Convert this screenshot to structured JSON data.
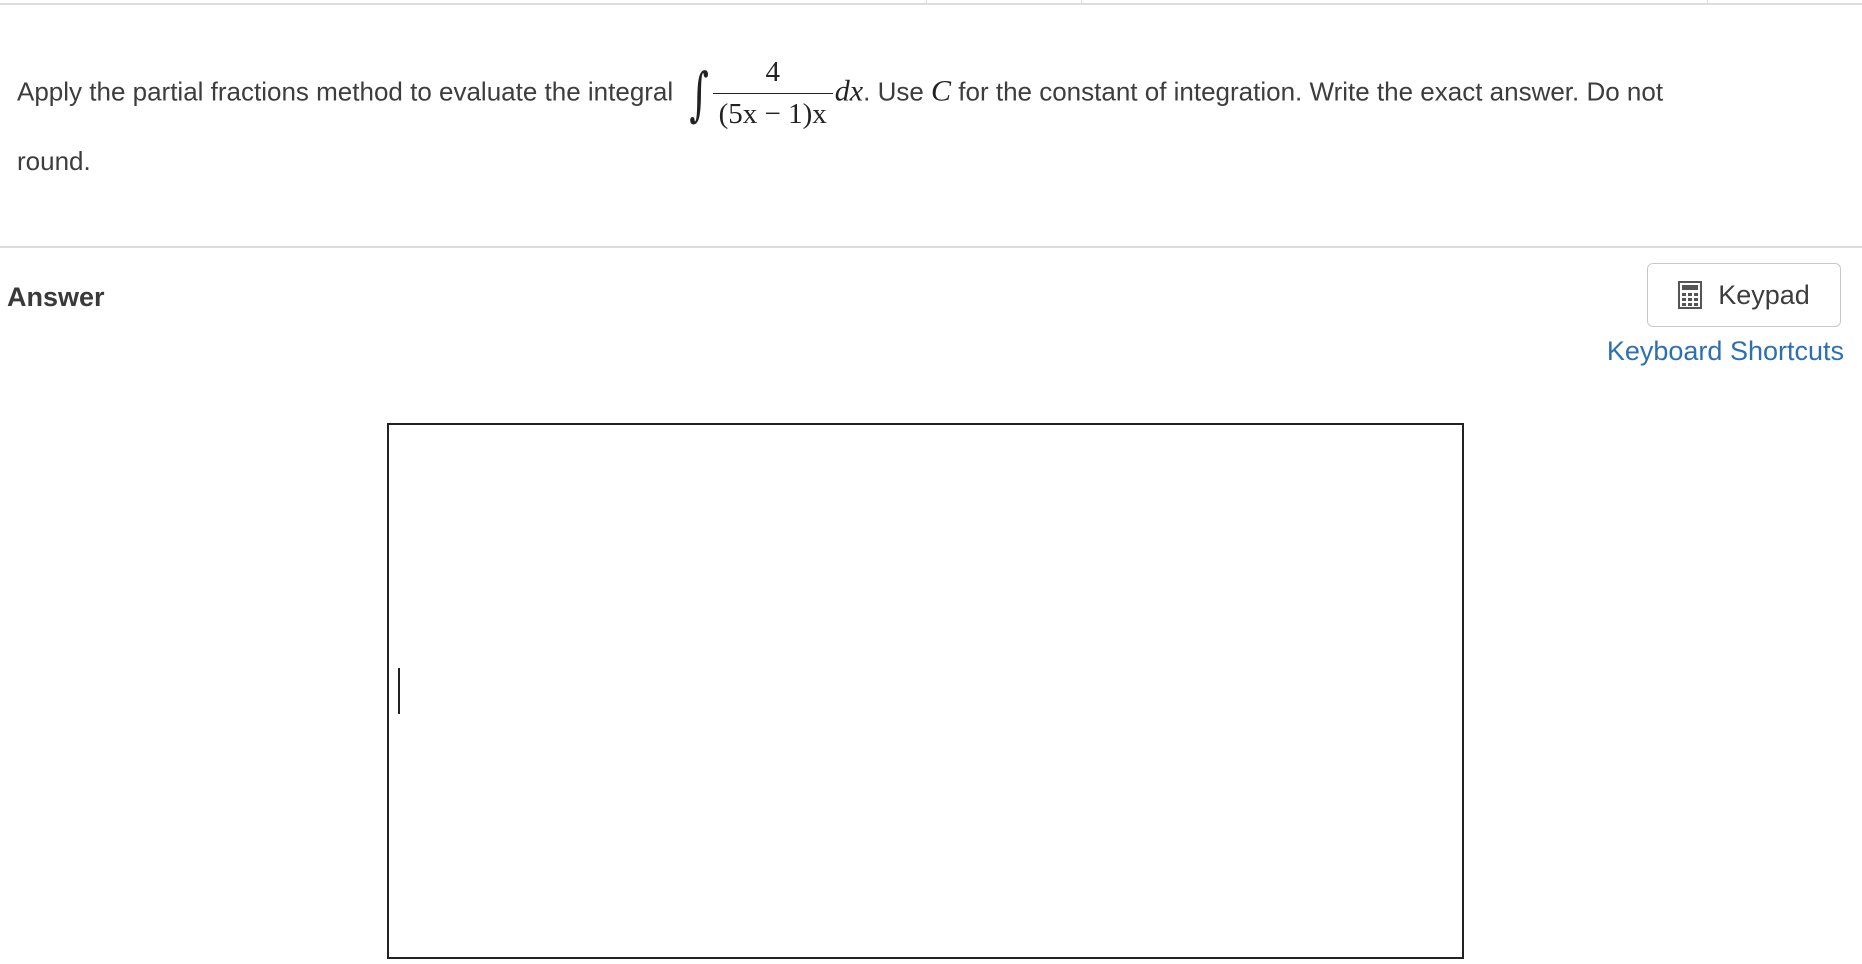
{
  "question": {
    "text_before": "Apply the partial fractions method to evaluate the integral",
    "integral_sign": "∫",
    "numerator": "4",
    "denominator": "(5x − 1)x",
    "differential": "dx",
    "text_middle_1": ". Use ",
    "constant": "C",
    "text_after": " for the constant of integration. Write the exact answer. Do not round."
  },
  "answer": {
    "label": "Answer",
    "input_value": ""
  },
  "keypad_button": {
    "label": "Keypad",
    "icon": "calculator-icon"
  },
  "keyboard_shortcuts_link": "Keyboard Shortcuts",
  "colors": {
    "link": "#2d6fb4",
    "text": "#3d3d3d",
    "divider": "#dcdcdc"
  }
}
